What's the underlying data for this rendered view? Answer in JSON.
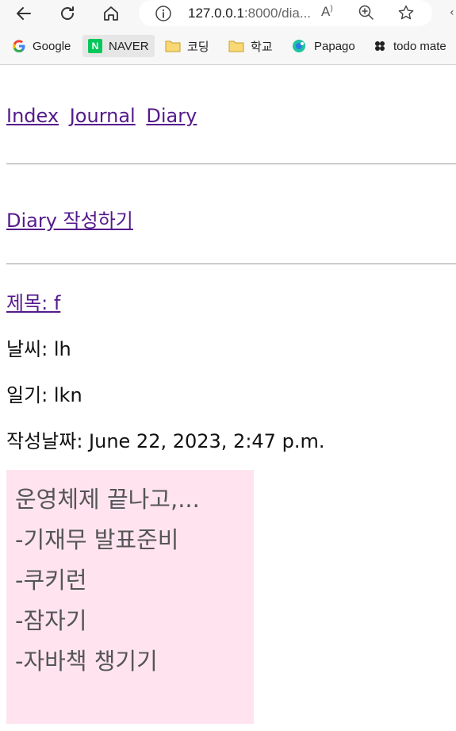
{
  "browser": {
    "url_host": "127.0.0.1",
    "url_rest": ":8000/dia...",
    "read_aloud_icon": "Aͅ",
    "bookmarks": [
      {
        "label": "Google",
        "icon": "google-icon"
      },
      {
        "label": "NAVER",
        "icon": "naver-icon"
      },
      {
        "label": "코딩",
        "icon": "folder-icon"
      },
      {
        "label": "학교",
        "icon": "folder-icon"
      },
      {
        "label": "Papago",
        "icon": "papago-icon"
      },
      {
        "label": "todo mate",
        "icon": "todo-mate-icon"
      }
    ]
  },
  "nav": {
    "index": "Index",
    "journal": "Journal",
    "diary": "Diary"
  },
  "create_link": "Diary 작성하기",
  "entry": {
    "title_label": "제목:",
    "title_value": "f",
    "weather_line": "날씨: lh",
    "diary_line": "일기: lkn",
    "date_line": "작성날짜: June 22, 2023, 2:47 p.m."
  },
  "memo_lines": [
    "운영체제 끝나고,...",
    "-기재무 발표준비",
    "-쿠키런",
    "-잠자기",
    "-자바책 챙기기"
  ],
  "colors": {
    "link": "#551a8b",
    "memo_bg": "#ffe4f0",
    "naver_green": "#03c75a",
    "folder_yellow": "#f3c44e"
  }
}
